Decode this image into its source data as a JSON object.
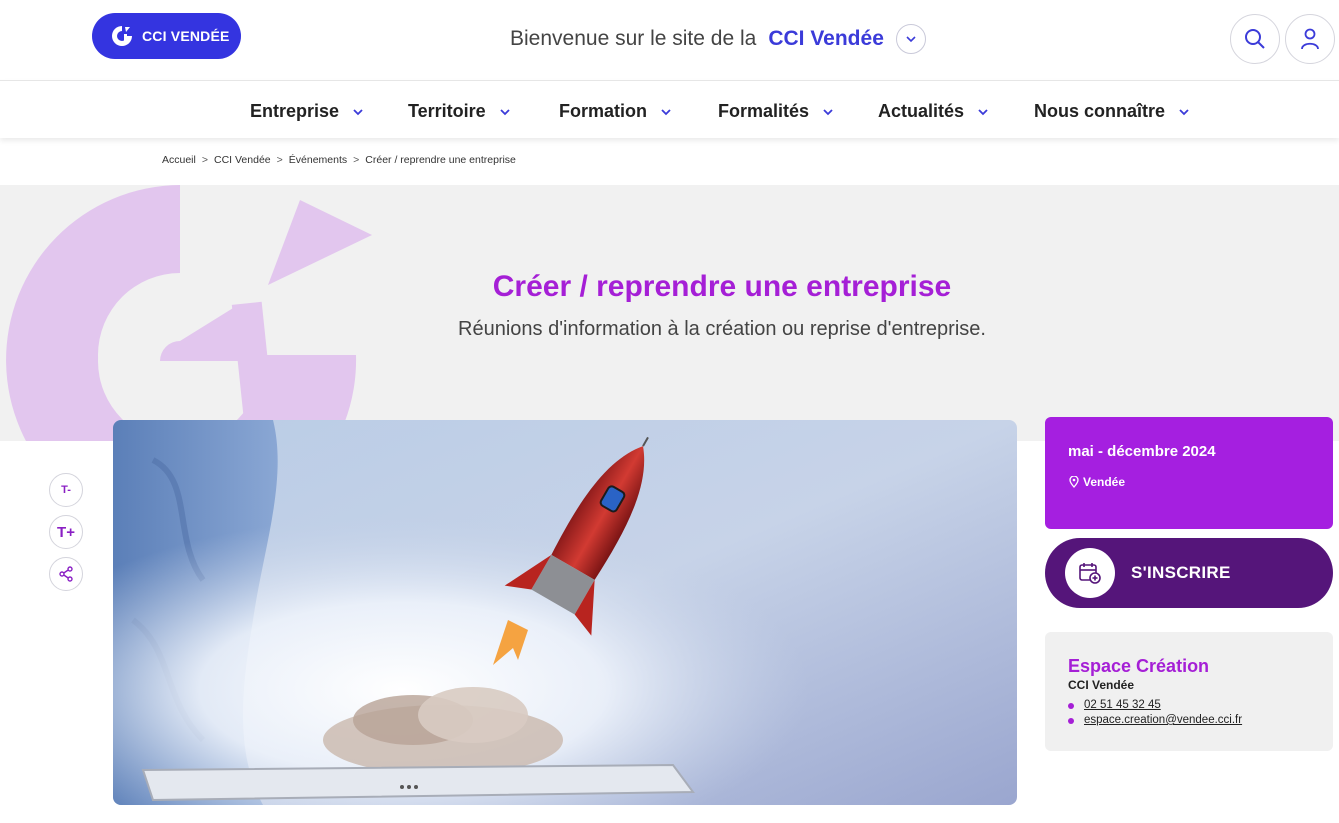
{
  "header": {
    "logo_text": "CCI VENDÉE",
    "welcome_text": "Bienvenue sur le site de la",
    "welcome_brand": "CCI Vendée",
    "search_icon": "search-icon",
    "user_icon": "user-icon"
  },
  "nav": {
    "items": [
      {
        "label": "Entreprise"
      },
      {
        "label": "Territoire"
      },
      {
        "label": "Formation"
      },
      {
        "label": "Formalités"
      },
      {
        "label": "Actualités"
      },
      {
        "label": "Nous connaître"
      }
    ]
  },
  "breadcrumb": [
    "Accueil",
    "CCI Vendée",
    "Événements",
    "Créer / reprendre une entreprise"
  ],
  "hero": {
    "title": "Créer / reprendre une entreprise",
    "subtitle": "Réunions d'information à la création ou reprise d'entreprise."
  },
  "tools": {
    "decrease_label": "T-",
    "increase_label": "T+",
    "share_icon": "share-icon"
  },
  "event": {
    "date": "mai - décembre 2024",
    "location": "Vendée",
    "register_label": "S'INSCRIRE"
  },
  "contact": {
    "title": "Espace Création",
    "org": "CCI Vendée",
    "phone": "02 51 45 32 45",
    "email": "espace.creation@vendee.cci.fr"
  },
  "colors": {
    "brand_blue": "#3434e0",
    "accent_purple": "#a51fd6",
    "dark_purple": "#55157a",
    "hero_bg": "#f1f1f1"
  }
}
